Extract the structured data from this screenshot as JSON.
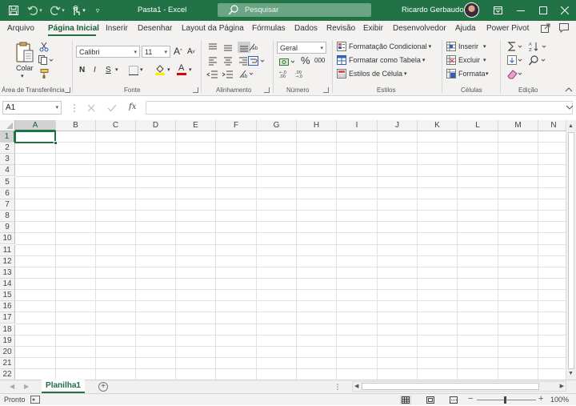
{
  "titlebar": {
    "title": "Pasta1  -  Excel",
    "search_placeholder": "Pesquisar",
    "user_name": "Ricardo Gerbaudo",
    "bg_color": "#217346"
  },
  "tabs": [
    {
      "label": "Arquivo"
    },
    {
      "label": "Página Inicial",
      "active": true
    },
    {
      "label": "Inserir"
    },
    {
      "label": "Desenhar"
    },
    {
      "label": "Layout da Página"
    },
    {
      "label": "Fórmulas"
    },
    {
      "label": "Dados"
    },
    {
      "label": "Revisão"
    },
    {
      "label": "Exibir"
    },
    {
      "label": "Desenvolvedor"
    },
    {
      "label": "Ajuda"
    },
    {
      "label": "Power Pivot"
    }
  ],
  "ribbon": {
    "clipboard": {
      "paste_label": "Colar",
      "group_label": "Área de Transferência"
    },
    "font": {
      "font_name": "Calibri",
      "font_size": "11",
      "bold": "N",
      "italic": "I",
      "underline": "S",
      "group_label": "Fonte",
      "grow": "A",
      "shrink": "A",
      "font_color_glyph": "A"
    },
    "alignment": {
      "group_label": "Alinhamento"
    },
    "number": {
      "format": "Geral",
      "percent": "%",
      "thousands": "000",
      "group_label": "Número"
    },
    "styles": {
      "conditional": "Formatação Condicional",
      "as_table": "Formatar como Tabela",
      "cell_styles": "Estilos de Célula",
      "group_label": "Estilos"
    },
    "cells": {
      "insert": "Inserir",
      "delete": "Excluir",
      "format": "Formatar",
      "group_label": "Células"
    },
    "editing": {
      "group_label": "Edição"
    }
  },
  "formula_bar": {
    "name_box": "A1",
    "fx": "fx",
    "value": ""
  },
  "grid": {
    "columns": [
      "A",
      "B",
      "C",
      "D",
      "E",
      "F",
      "G",
      "H",
      "I",
      "J",
      "K",
      "L",
      "M",
      "N"
    ],
    "rows": [
      "1",
      "2",
      "3",
      "4",
      "5",
      "6",
      "7",
      "8",
      "9",
      "10",
      "11",
      "12",
      "13",
      "14",
      "15",
      "16",
      "17",
      "18",
      "19",
      "20",
      "21",
      "22"
    ],
    "selected_cell": "A1"
  },
  "sheets": [
    {
      "name": "Planilha1",
      "active": true
    }
  ],
  "statusbar": {
    "status": "Pronto",
    "zoom": "100%"
  }
}
